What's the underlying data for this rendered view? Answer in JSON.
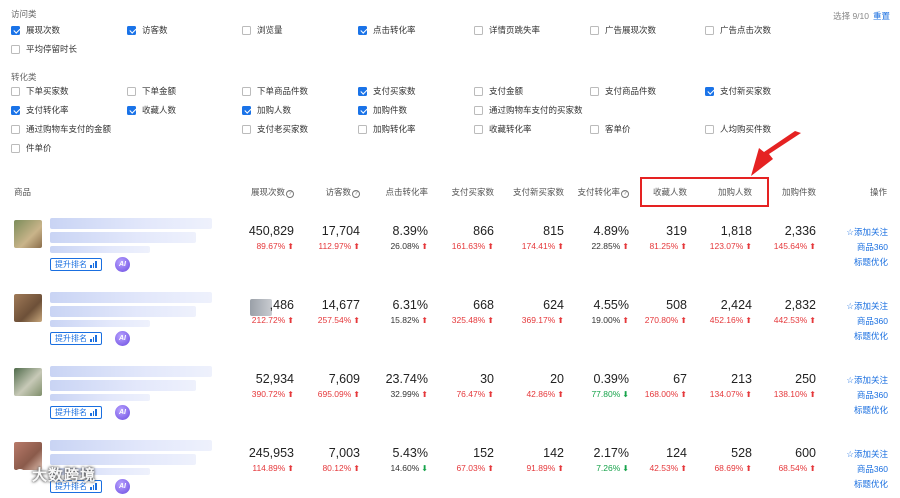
{
  "selection": {
    "count_text": "选择 9/10",
    "reset_label": "重置"
  },
  "visit_section": {
    "title": "访问类",
    "items": [
      {
        "label": "展现次数",
        "checked": true
      },
      {
        "label": "访客数",
        "checked": true
      },
      {
        "label": "浏览量",
        "checked": false
      },
      {
        "label": "点击转化率",
        "checked": true
      },
      {
        "label": "详情页跳失率",
        "checked": false
      },
      {
        "label": "广告展现次数",
        "checked": false
      },
      {
        "label": "广告点击次数",
        "checked": false
      },
      {
        "label": "平均停留时长",
        "checked": false
      }
    ]
  },
  "conv_section": {
    "title": "转化类",
    "items": [
      {
        "label": "下单买家数",
        "checked": false
      },
      {
        "label": "下单金额",
        "checked": false
      },
      {
        "label": "下单商品件数",
        "checked": false
      },
      {
        "label": "支付买家数",
        "checked": true
      },
      {
        "label": "支付金额",
        "checked": false
      },
      {
        "label": "支付商品件数",
        "checked": false
      },
      {
        "label": "支付新买家数",
        "checked": true
      },
      {
        "label": "支付转化率",
        "checked": true
      },
      {
        "label": "收藏人数",
        "checked": true
      },
      {
        "label": "加购人数",
        "checked": true
      },
      {
        "label": "加购件数",
        "checked": true
      },
      {
        "label": "通过购物车支付的买家数",
        "checked": false
      },
      {
        "label": "通过购物车支付的金额",
        "checked": false
      },
      {
        "label": "支付老买家数",
        "checked": false
      },
      {
        "label": "加购转化率",
        "checked": false
      },
      {
        "label": "收藏转化率",
        "checked": false
      },
      {
        "label": "客单价",
        "checked": false
      },
      {
        "label": "人均购买件数",
        "checked": false
      },
      {
        "label": "件单价",
        "checked": false
      }
    ]
  },
  "table": {
    "headers": [
      "商品",
      "展现次数",
      "访客数",
      "点击转化率",
      "支付买家数",
      "支付新买家数",
      "支付转化率",
      "收藏人数",
      "加购人数",
      "加购件数",
      "操作"
    ],
    "rank_label": "提升排名",
    "ai_label": "AI",
    "ops": [
      "添加关注",
      "商品360",
      "标题优化"
    ],
    "rows": [
      {
        "cells": [
          {
            "v": "450,829",
            "p": "89.67%",
            "d": "up"
          },
          {
            "v": "17,704",
            "p": "112.97%",
            "d": "up"
          },
          {
            "v": "8.39%",
            "p": "26.08%",
            "d": "up"
          },
          {
            "v": "866",
            "p": "161.63%",
            "d": "up"
          },
          {
            "v": "815",
            "p": "174.41%",
            "d": "up"
          },
          {
            "v": "4.89%",
            "p": "22.85%",
            "d": "up"
          },
          {
            "v": "319",
            "p": "81.25%",
            "d": "up"
          },
          {
            "v": "1,818",
            "p": "123.07%",
            "d": "up"
          },
          {
            "v": "2,336",
            "p": "145.64%",
            "d": "up"
          }
        ]
      },
      {
        "cells": [
          {
            "v": ",486",
            "p": "212.72%",
            "d": "up"
          },
          {
            "v": "14,677",
            "p": "257.54%",
            "d": "up"
          },
          {
            "v": "6.31%",
            "p": "15.82%",
            "d": "up"
          },
          {
            "v": "668",
            "p": "325.48%",
            "d": "up"
          },
          {
            "v": "624",
            "p": "369.17%",
            "d": "up"
          },
          {
            "v": "4.55%",
            "p": "19.00%",
            "d": "up"
          },
          {
            "v": "508",
            "p": "270.80%",
            "d": "up"
          },
          {
            "v": "2,424",
            "p": "452.16%",
            "d": "up"
          },
          {
            "v": "2,832",
            "p": "442.53%",
            "d": "up"
          }
        ]
      },
      {
        "cells": [
          {
            "v": "52,934",
            "p": "390.72%",
            "d": "up"
          },
          {
            "v": "7,609",
            "p": "695.09%",
            "d": "up"
          },
          {
            "v": "23.74%",
            "p": "32.99%",
            "d": "up"
          },
          {
            "v": "30",
            "p": "76.47%",
            "d": "up"
          },
          {
            "v": "20",
            "p": "42.86%",
            "d": "up"
          },
          {
            "v": "0.39%",
            "p": "77.80%",
            "d": "down"
          },
          {
            "v": "67",
            "p": "168.00%",
            "d": "up"
          },
          {
            "v": "213",
            "p": "134.07%",
            "d": "up"
          },
          {
            "v": "250",
            "p": "138.10%",
            "d": "up"
          }
        ]
      },
      {
        "cells": [
          {
            "v": "245,953",
            "p": "114.89%",
            "d": "up"
          },
          {
            "v": "7,003",
            "p": "80.12%",
            "d": "up"
          },
          {
            "v": "5.43%",
            "p": "14.60%",
            "d": "down"
          },
          {
            "v": "152",
            "p": "67.03%",
            "d": "up"
          },
          {
            "v": "142",
            "p": "91.89%",
            "d": "up"
          },
          {
            "v": "2.17%",
            "p": "7.26%",
            "d": "down"
          },
          {
            "v": "124",
            "p": "42.53%",
            "d": "up"
          },
          {
            "v": "528",
            "p": "68.69%",
            "d": "up"
          },
          {
            "v": "600",
            "p": "68.54%",
            "d": "up"
          }
        ]
      }
    ]
  },
  "watermark": "大数跨境",
  "colors": {
    "accent": "#1a73e8",
    "up": "#e5383b",
    "down": "#16a34a",
    "highlight": "#e52222"
  }
}
